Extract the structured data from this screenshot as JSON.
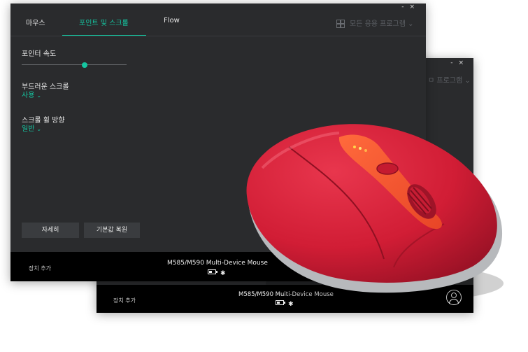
{
  "back_window": {
    "controls": [
      "-",
      "×"
    ],
    "app_selector_partial": "ㅁ 프로그램 ⌄",
    "footer": {
      "add_device": "장치 추가",
      "device_name": "M585/M590 Multi-Device Mouse",
      "connection_icons": "▭ ✱"
    }
  },
  "front_window": {
    "controls": [
      "-",
      "×"
    ],
    "tabs": [
      {
        "label": "마우스",
        "active": false
      },
      {
        "label": "포인트 및 스크롤",
        "active": true
      },
      {
        "label": "Flow",
        "active": false
      }
    ],
    "app_selector": {
      "label": "모든 응용 프로그램",
      "chevron": "⌄",
      "icon": "grid-icon"
    },
    "settings": {
      "pointer_speed": {
        "label": "포인터 속도",
        "value": 0.6
      },
      "smooth_scroll": {
        "label": "부드러운 스크롤",
        "value": "사용"
      },
      "scroll_direction": {
        "label": "스크롤 휠 방향",
        "value": "일반"
      }
    },
    "buttons": {
      "more": "자세히",
      "restore_defaults": "기본값 복원"
    },
    "footer": {
      "add_device": "장치 추가",
      "device_name": "M585/M590 Multi-Device Mouse",
      "icons": [
        "battery-icon",
        "bluetooth-icon"
      ]
    }
  },
  "colors": {
    "accent": "#15c6a1",
    "window_bg": "#2a2b2d",
    "footer_bg": "#000000",
    "mouse_red": "#d41f36"
  }
}
